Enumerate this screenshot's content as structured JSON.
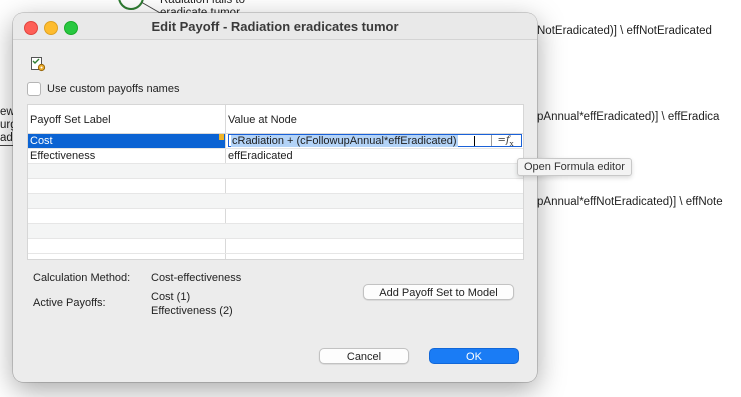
{
  "background": {
    "top_label": "Radiation fails to eradicate tumor",
    "left_fragments": [
      "ew",
      "urg",
      "adi"
    ],
    "right_texts": [
      "NotEradicated)] \\ effNotEradicated",
      "pAnnual*effEradicated)] \\ effEradica",
      "pAnnual*effNotEradicated)] \\ effNote"
    ]
  },
  "dialog": {
    "title": "Edit Payoff - Radiation eradicates tumor",
    "custom_names_label": "Use custom payoffs names",
    "custom_names_checked": false,
    "table": {
      "headers": [
        "Payoff Set Label",
        "Value at Node"
      ],
      "rows": [
        {
          "label": "Cost",
          "value": "cRadiation + (cFollowupAnnual*effEradicated)"
        },
        {
          "label": "Effectiveness",
          "value": "effEradicated"
        }
      ],
      "fx_button": "=fx"
    },
    "tooltip": "Open Formula editor",
    "calculation_method_label": "Calculation Method:",
    "calculation_method_value": "Cost-effectiveness",
    "active_payoffs_label": "Active Payoffs:",
    "active_payoffs": [
      "Cost (1)",
      "Effectiveness (2)"
    ],
    "add_payoff_button": "Add Payoff Set to Model",
    "cancel_button": "Cancel",
    "ok_button": "OK"
  },
  "colors": {
    "selection": "#0b63d3",
    "primary_button": "#1a7cf5",
    "note_marker": "#f0b429"
  }
}
